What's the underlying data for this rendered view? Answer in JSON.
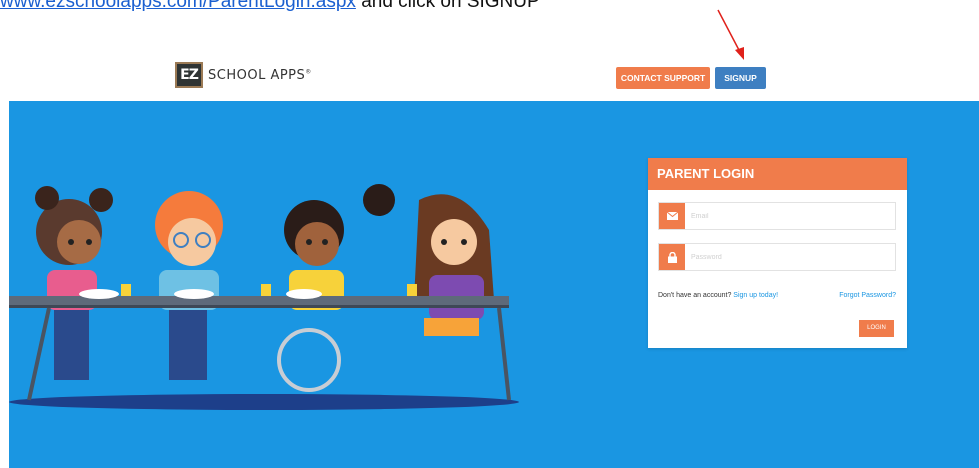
{
  "instruction": {
    "link_text": "www.ezschoolapps.com/ParentLogin.aspx",
    "text": " and click on SIGNUP"
  },
  "header": {
    "logo_mark": "EZ",
    "logo_text": "SCHOOL APPS",
    "logo_tm": "®",
    "contact_support_label": "CONTACT SUPPORT",
    "signup_label": "SIGNUP"
  },
  "login": {
    "title": "PARENT LOGIN",
    "email_placeholder": "Email",
    "password_placeholder": "Password",
    "account_prompt": "Don't have an account? ",
    "signup_link": "Sign up today!",
    "forgot_password": "Forgot Password?",
    "login_button": "LOGIN"
  },
  "colors": {
    "hero_blue": "#1a96e2",
    "accent_orange": "#f07c4b",
    "signup_blue": "#3e7fc1",
    "annotation_red": "#e0211b"
  },
  "icons": [
    "envelope-icon",
    "lock-icon",
    "annotation-arrow-icon"
  ]
}
